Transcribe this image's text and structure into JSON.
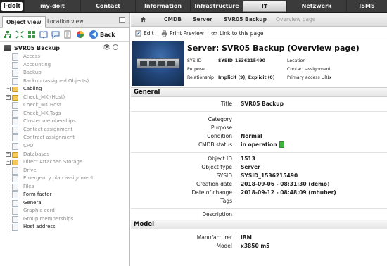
{
  "nav": {
    "logo": "i-doit",
    "items": [
      "my-doit",
      "Contact",
      "Information",
      "Infrastructure",
      "IT",
      "Netzwerk",
      "ISMS"
    ],
    "active": "IT"
  },
  "left_panel": {
    "tabs": [
      "Object view",
      "Location view"
    ],
    "back_label": "Back",
    "root": "SVR05 Backup",
    "tree": [
      {
        "label": "Access",
        "type": "doc",
        "muted": true
      },
      {
        "label": "Accounting",
        "type": "doc",
        "muted": true
      },
      {
        "label": "Backup",
        "type": "doc",
        "muted": true
      },
      {
        "label": "Backup (assigned Objects)",
        "type": "doc",
        "muted": true
      },
      {
        "label": "Cabling",
        "type": "folder",
        "muted": false,
        "expandable": true
      },
      {
        "label": "Check_MK (Host)",
        "type": "folder",
        "muted": true,
        "expandable": true
      },
      {
        "label": "Check_MK Host",
        "type": "doc",
        "muted": true
      },
      {
        "label": "Check_MK Tags",
        "type": "doc",
        "muted": true
      },
      {
        "label": "Cluster memberships",
        "type": "doc",
        "muted": true
      },
      {
        "label": "Contact assignment",
        "type": "doc",
        "muted": true
      },
      {
        "label": "Contract assignment",
        "type": "doc",
        "muted": true
      },
      {
        "label": "CPU",
        "type": "doc",
        "muted": true
      },
      {
        "label": "Databases",
        "type": "folder",
        "muted": true,
        "expandable": true
      },
      {
        "label": "Direct Attached Storage",
        "type": "folder",
        "muted": true,
        "expandable": true
      },
      {
        "label": "Drive",
        "type": "doc",
        "muted": true
      },
      {
        "label": "Emergency plan assignment",
        "type": "doc",
        "muted": true
      },
      {
        "label": "Files",
        "type": "doc",
        "muted": true
      },
      {
        "label": "Form factor",
        "type": "doc",
        "muted": false
      },
      {
        "label": "General",
        "type": "doc",
        "muted": false
      },
      {
        "label": "Graphic card",
        "type": "doc",
        "muted": true
      },
      {
        "label": "Group memberships",
        "type": "doc",
        "muted": true
      },
      {
        "label": "Host address",
        "type": "doc",
        "muted": false
      }
    ]
  },
  "breadcrumb": [
    "CMDB",
    "Server",
    "SVR05 Backup",
    "Overview page"
  ],
  "actions": {
    "edit": "Edit",
    "print": "Print Preview",
    "link": "Link to this page"
  },
  "header": {
    "title": "Server: SVR05 Backup (Overview page)",
    "sysid_label": "SYS-ID",
    "sysid_value": "SYSID_1536215490",
    "purpose_label": "Purpose",
    "relationship_label": "Relationship",
    "relationship_value": "Implicit (9), Explicit (0)",
    "location_label": "Location",
    "contact_label": "Contact assignment",
    "access_label": "Primary access URL",
    "access_caret": "▾"
  },
  "general": {
    "section_title": "General",
    "title_label": "Title",
    "title_value": "SVR05 Backup",
    "category_label": "Category",
    "purpose_label": "Purpose",
    "condition_label": "Condition",
    "condition_value": "Normal",
    "cmdb_label": "CMDB status",
    "cmdb_value": "in operation",
    "objid_label": "Object ID",
    "objid_value": "1513",
    "objtype_label": "Object type",
    "objtype_value": "Server",
    "sysid_label": "SYSID",
    "sysid_value": "SYSID_1536215490",
    "created_label": "Creation date",
    "created_value": "2018-09-06 - 08:31:30 (demo)",
    "changed_label": "Date of change",
    "changed_value": "2018-09-12 - 08:48:09 (mhuber)",
    "tags_label": "Tags",
    "description_label": "Description"
  },
  "model": {
    "section_title": "Model",
    "manufacturer_label": "Manufacturer",
    "manufacturer_value": "IBM",
    "model_label": "Model",
    "model_value": "x3850 m5"
  },
  "colors": {
    "nav_bg": "#3b3b3b",
    "status_green": "#3cb93c",
    "folder": "#f3c95b"
  }
}
